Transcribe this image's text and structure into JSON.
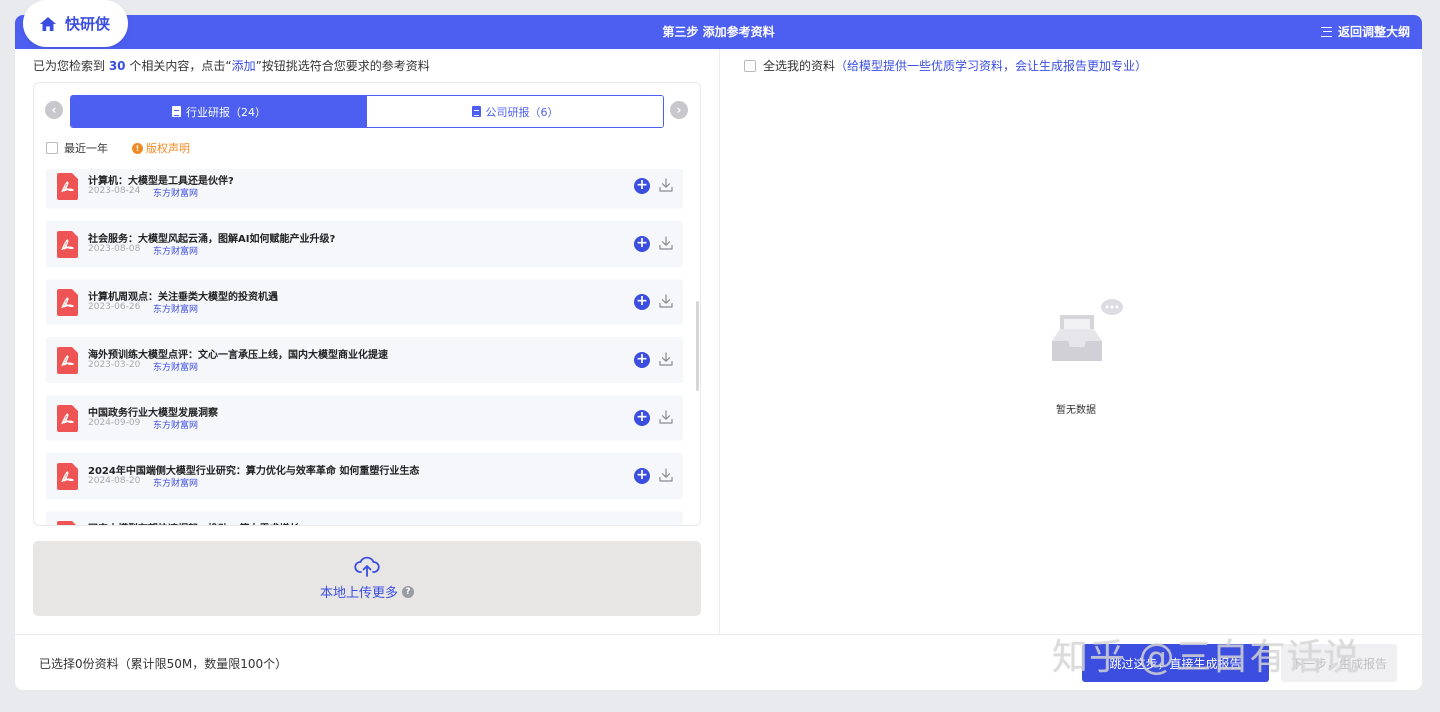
{
  "app": {
    "name": "快研侠"
  },
  "header": {
    "step_title": "第三步 添加参考资料",
    "back_label": "返回调整大纲"
  },
  "left": {
    "found_prefix": "已为您检索到 ",
    "found_count": "30",
    "found_mid": " 个相关内容，点击“",
    "found_add": "添加",
    "found_suffix": "”按钮挑选符合您要求的参考资料",
    "tabs": [
      {
        "label": "行业研报（24）",
        "active": true
      },
      {
        "label": "公司研报（6）",
        "active": false
      }
    ],
    "filter_recent_year": "最近一年",
    "copyright_label": "版权声明",
    "items": [
      {
        "title": "计算机：大模型是工具还是伙伴?",
        "date": "2023-08-24",
        "source": "东方财富网"
      },
      {
        "title": "社会服务：大模型风起云涌，图解AI如何赋能产业升级?",
        "date": "2023-08-08",
        "source": "东方财富网"
      },
      {
        "title": "计算机周观点：关注垂类大模型的投资机遇",
        "date": "2023-06-26",
        "source": "东方财富网"
      },
      {
        "title": "海外预训练大模型点评：文心一言承压上线，国内大模型商业化提速",
        "date": "2023-03-20",
        "source": "东方财富网"
      },
      {
        "title": "中国政务行业大模型发展洞察",
        "date": "2024-09-09",
        "source": "东方财富网"
      },
      {
        "title": "2024年中国端侧大模型行业研究：算力优化与效率革命 如何重塑行业生态",
        "date": "2024-08-20",
        "source": "东方财富网"
      },
      {
        "title": "国产大模型有望快速崛起，推动AI算力需求增长",
        "date": "",
        "source": ""
      }
    ],
    "upload_label": "本地上传更多",
    "help_glyph": "?"
  },
  "right": {
    "select_all_label": "全选我的资料",
    "select_all_hint": "（给模型提供一些优质学习资料，会让生成报告更加专业）",
    "empty_text": "暂无数据"
  },
  "footer": {
    "selection_text": "已选择0份资料（累计限50M，数量限100个）",
    "skip_button": "跳过这步，直接生成报告",
    "next_button": "下一步，生成报告"
  },
  "watermark": "知乎 @三白有话说",
  "colors": {
    "accent": "#4c5ff0",
    "link": "#3b4ee0",
    "pdf": "#ee5454",
    "warning": "#f08a24"
  }
}
